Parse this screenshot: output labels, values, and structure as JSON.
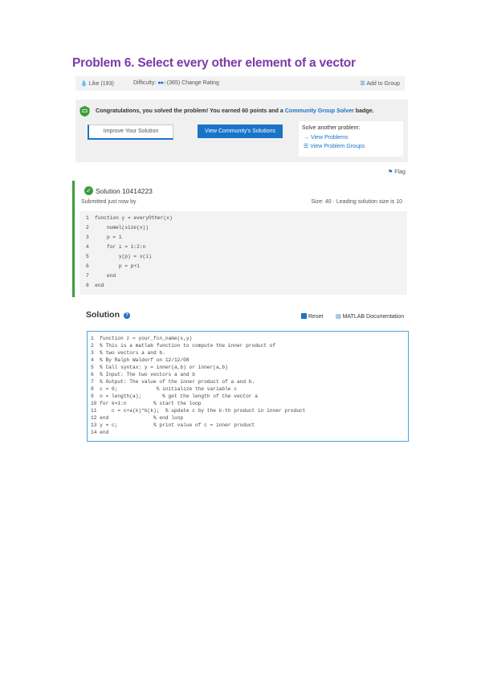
{
  "problem": {
    "title": "Problem 6. Select every other element of a vector"
  },
  "meta": {
    "like_icon": "drop-icon",
    "like_label": "Like (193)",
    "difficulty_label": "Difficulty:",
    "difficulty_dots": "●●○",
    "difficulty_value": "(365)",
    "change_rating": "Change Rating",
    "add_to_group": "Add to Group"
  },
  "congrats": {
    "message_pre": "Congratulations, you solved the problem! You earned 60 points and a",
    "badge_link": "Community Group Solver",
    "message_post": "badge.",
    "improve_button": "Improve Your Solution",
    "community_button": "View Community's Solutions",
    "solve_another_heading": "Solve another problem:",
    "view_problems": "View Problems",
    "view_problem_groups": "View Problem Groups"
  },
  "flag_label": "Flag",
  "solution_card": {
    "id": "Solution 10414223",
    "submitted": "Submitted just now by",
    "size_info": "Size: 40 · Leading solution size is 10",
    "code_lines": [
      "1  function y = everyOther(x)",
      "2      numel(size(x))",
      "3      p = 1",
      "4      for i = 1:2:n",
      "5          y(p) = x(i)",
      "6          p = p+1",
      "7      end",
      "8  end"
    ]
  },
  "editor": {
    "heading": "Solution",
    "reset": "Reset",
    "matlab_doc": "MATLAB Documentation",
    "code_lines": [
      "1  function z = your_fcn_name(x,y)",
      "2  % This is a matlab function to compute the inner product of",
      "3  % two vectors a and b.",
      "4  % By Ralph Waldorf on 12/12/08",
      "5  % Call syntax: y = inner(a,b) or inner(a,b)",
      "6  % Input: The two vectors a and b",
      "7  % Output: The value of the inner product of a and b.",
      "8  c = 0;             % initialize the variable c",
      "9  n = length(a);       % get the length of the vector a",
      "10 for k=1:n         % start the loop",
      "11     c = c+a(k)*b(k);  % update c by the k-th product in inner product",
      "12 end               % end loop",
      "13 y = c;            % print value of c = inner product",
      "14 end"
    ]
  },
  "colors": {
    "title_purple": "#7c3aa8",
    "link_blue": "#1a73c7",
    "success_green": "#3a9d3a",
    "editor_border": "#4aa3df"
  }
}
